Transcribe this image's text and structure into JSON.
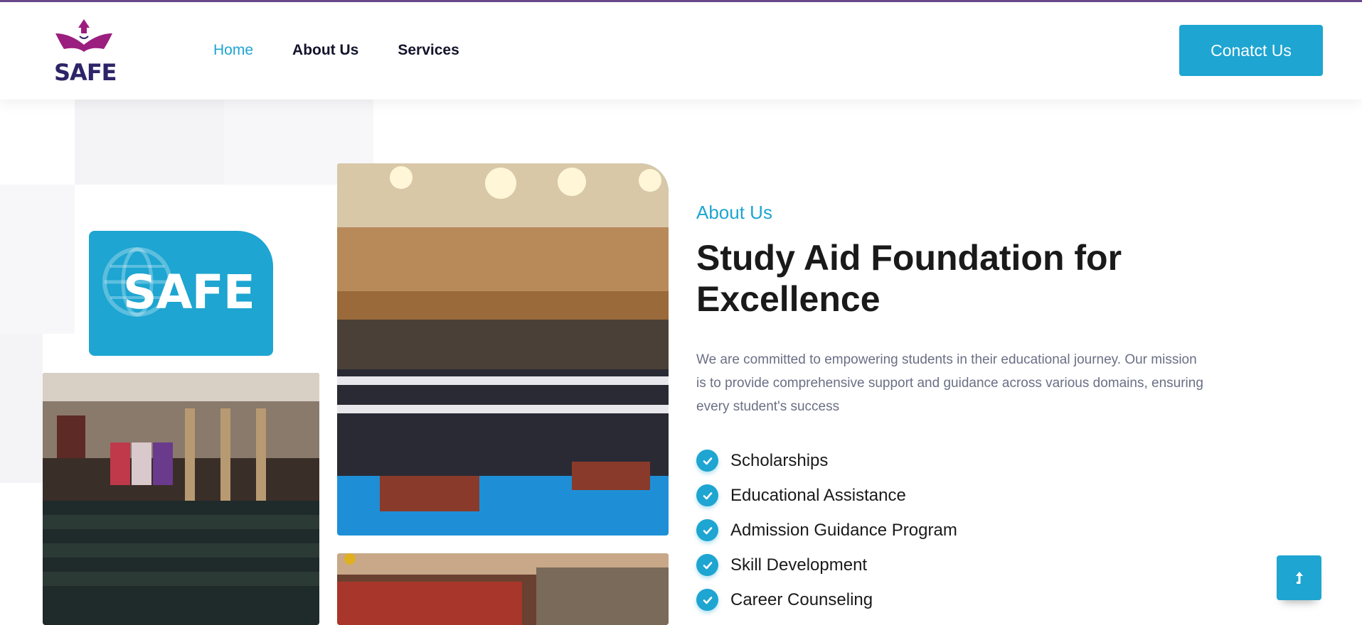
{
  "brand": {
    "logo_text": "SAFE"
  },
  "nav": {
    "items": [
      {
        "label": "Home",
        "active": true
      },
      {
        "label": "About Us",
        "active": false
      },
      {
        "label": "Services",
        "active": false
      }
    ]
  },
  "header": {
    "cta_label": "Conatct Us"
  },
  "hero_card": {
    "text": "SAFE"
  },
  "about": {
    "label": "About Us",
    "title": "Study Aid Foundation for Excellence",
    "description": "We are committed to empowering students in their educational journey. Our mission is to provide comprehensive support and guidance across various domains, ensuring every student's success",
    "features": [
      "Scholarships",
      "Educational Assistance",
      "Admission Guidance Program",
      "Skill Development",
      "Career Counseling"
    ]
  },
  "icons": {
    "feature_check": "check-circle-icon",
    "scroll_top": "arrow-up-icon",
    "card_globe": "globe-icon"
  },
  "colors": {
    "accent": "#1ea5d1",
    "brand_purple": "#9b1f7f",
    "brand_navy": "#2d2468",
    "heading": "#1a1a1a",
    "body_text": "#6a6f84"
  }
}
